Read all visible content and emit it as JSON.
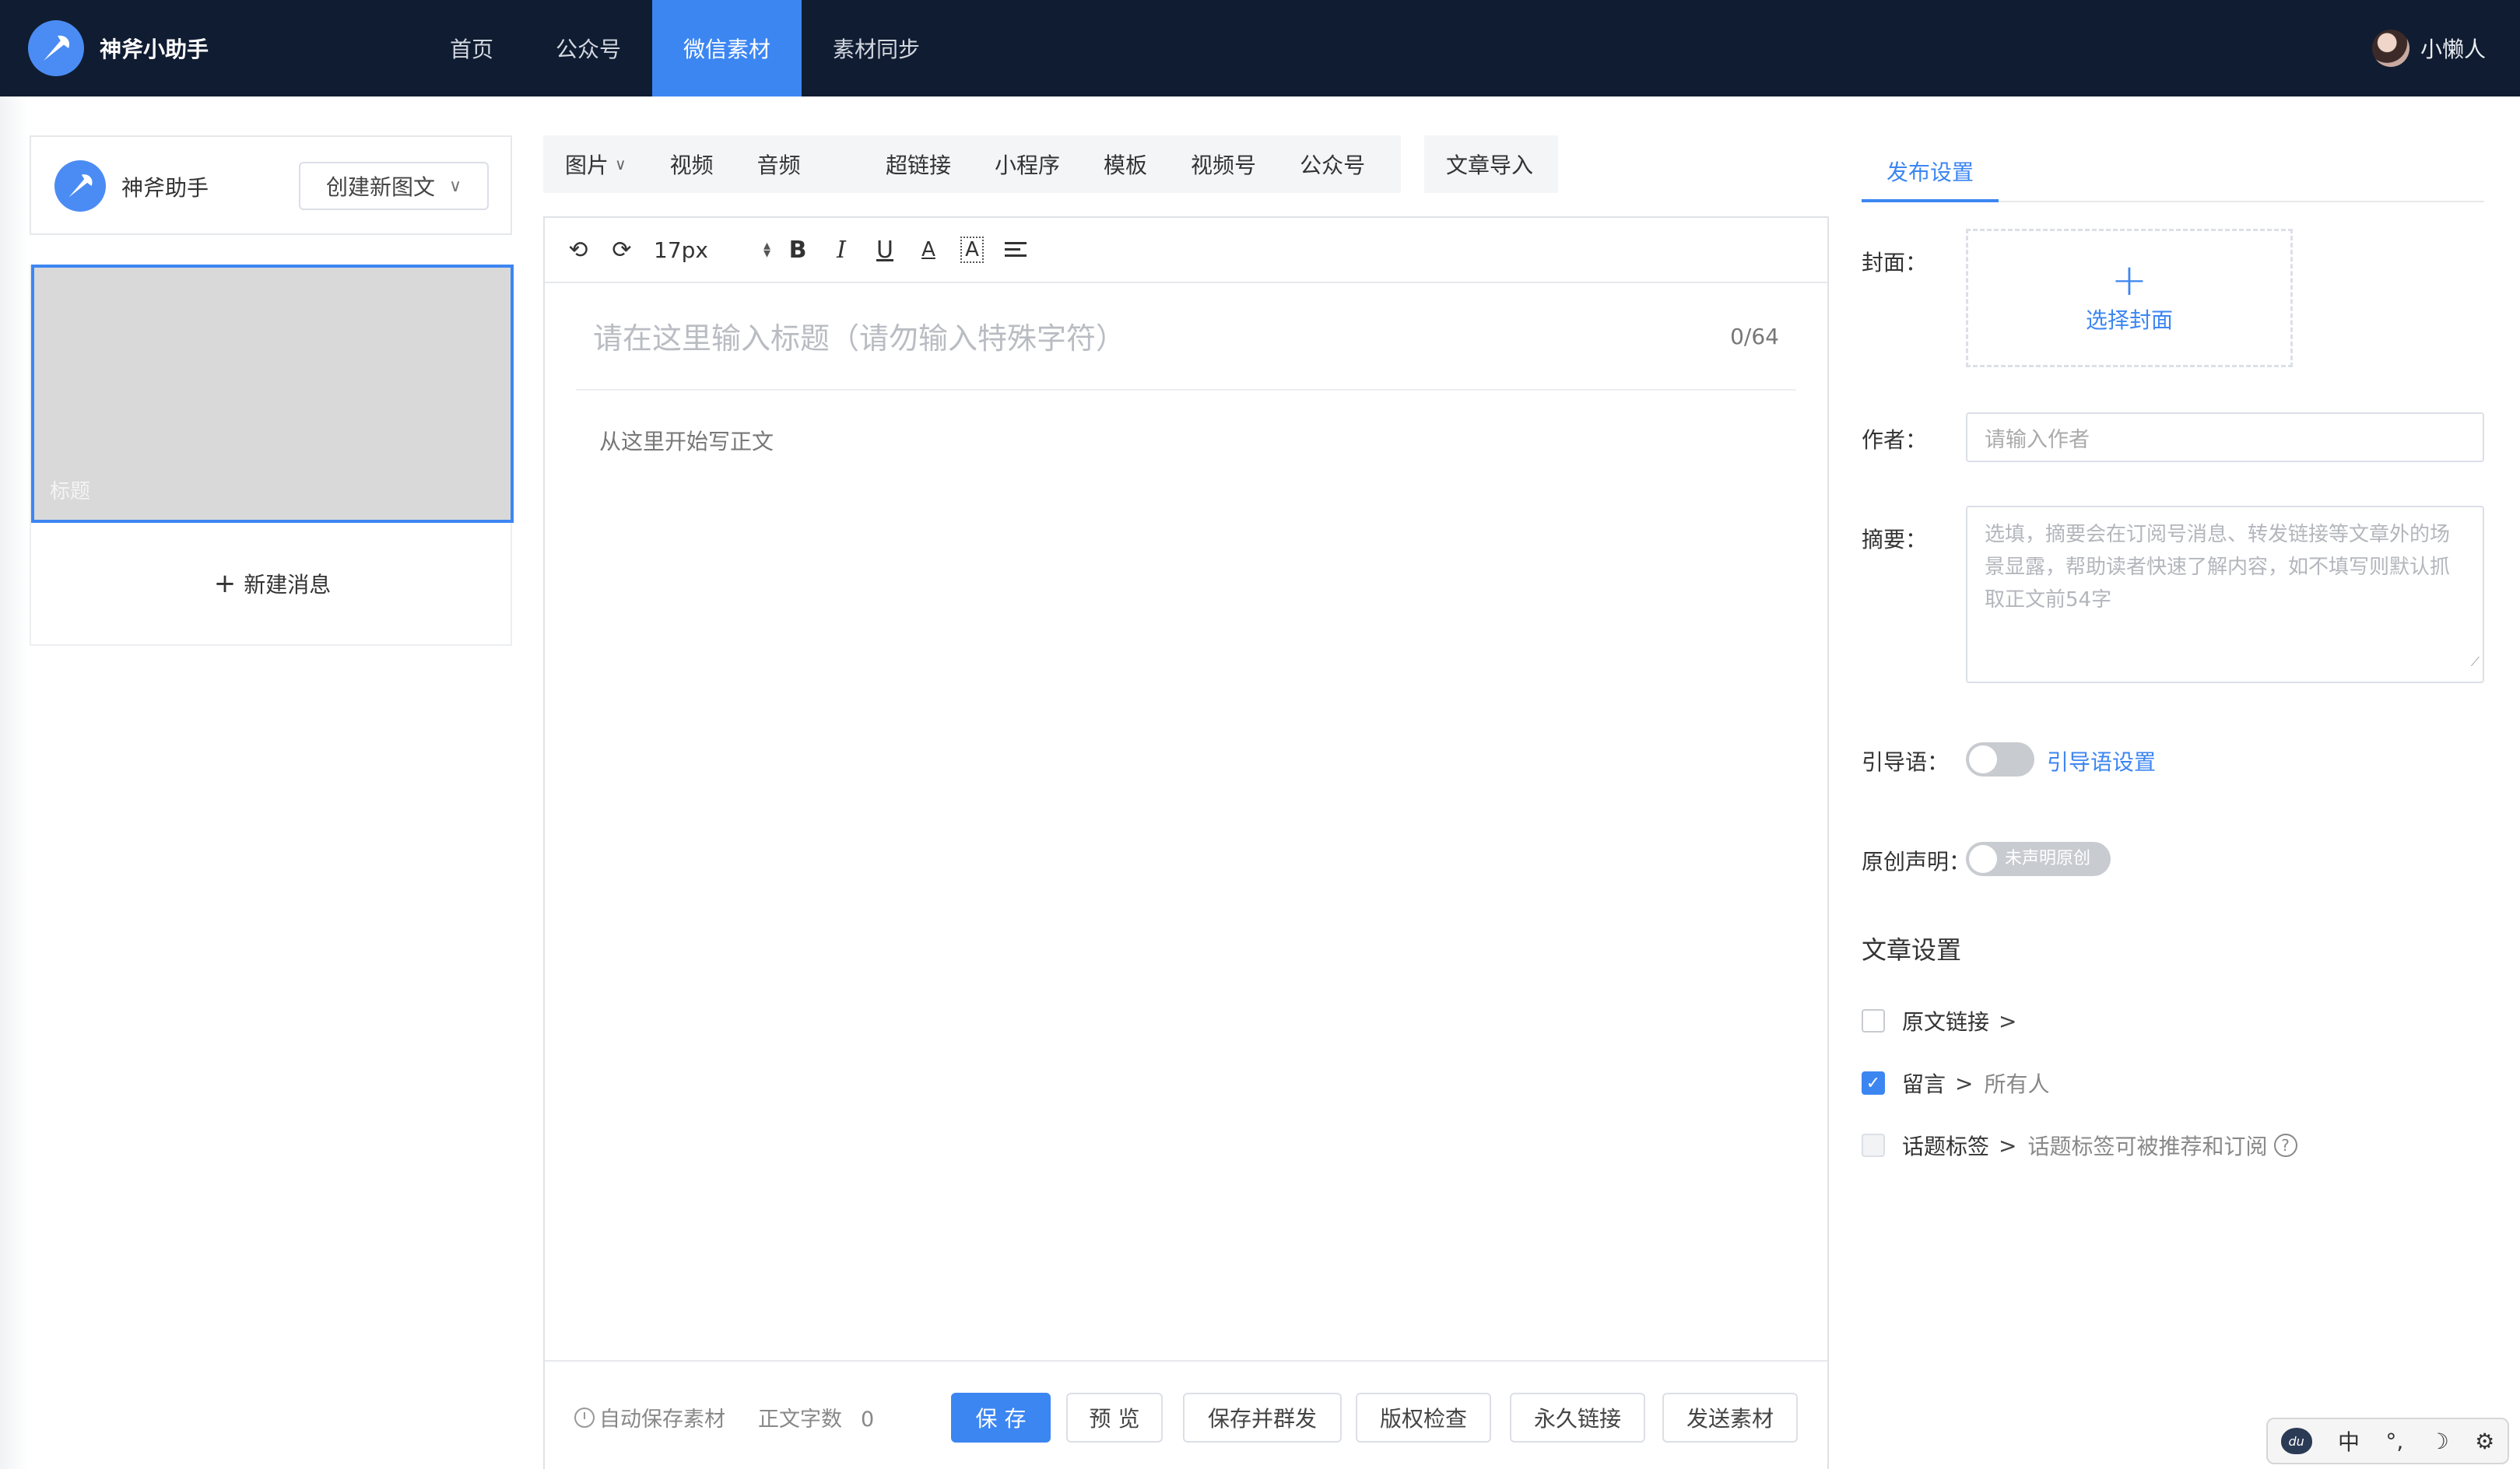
{
  "brand": {
    "name": "神斧小助手"
  },
  "nav": {
    "items": [
      "首页",
      "公众号",
      "微信素材",
      "素材同步"
    ],
    "active_index": 2
  },
  "user": {
    "name": "小懒人"
  },
  "left": {
    "account_name": "神斧助手",
    "create_button": "创建新图文",
    "message_title": "标题",
    "new_message": "新建消息"
  },
  "insert_toolbar": {
    "group1": [
      "图片",
      "视频",
      "音频"
    ],
    "group2": [
      "超链接",
      "小程序",
      "模板",
      "视频号",
      "公众号"
    ],
    "group3": [
      "文章导入"
    ]
  },
  "format_toolbar": {
    "font_size": "17px"
  },
  "editor": {
    "title_placeholder": "请在这里输入标题（请勿输入特殊字符）",
    "title_count": "0/64",
    "body_placeholder": "从这里开始写正文"
  },
  "footer": {
    "autosave": "自动保存素材",
    "wordcount_label": "正文字数",
    "wordcount_value": "0",
    "buttons": {
      "save": "保 存",
      "preview": "预 览",
      "save_send": "保存并群发",
      "copyright": "版权检查",
      "permalink": "永久链接",
      "send": "发送素材"
    }
  },
  "publish": {
    "tab": "发布设置",
    "cover_label": "封面：",
    "cover_select": "选择封面",
    "author_label": "作者：",
    "author_placeholder": "请输入作者",
    "summary_label": "摘要：",
    "summary_placeholder": "选填，摘要会在订阅号消息、转发链接等文章外的场景显露，帮助读者快速了解内容，如不填写则默认抓取正文前54字",
    "guide_label": "引导语：",
    "guide_link": "引导语设置",
    "original_label": "原创声明：",
    "original_toggle": "未声明原创",
    "article_settings": "文章设置",
    "options": {
      "original_link": "原文链接",
      "comment": "留言",
      "comment_value": "所有人",
      "topic_tag": "话题标签",
      "topic_tag_desc": "话题标签可被推荐和订阅"
    }
  },
  "ime": {
    "lang": "中",
    "punct": "°,",
    "moon": "☽",
    "gear": "⚙"
  },
  "colors": {
    "nav_bg": "#101c31",
    "accent": "#3c86f2",
    "card_bg": "#d9d9d9"
  }
}
